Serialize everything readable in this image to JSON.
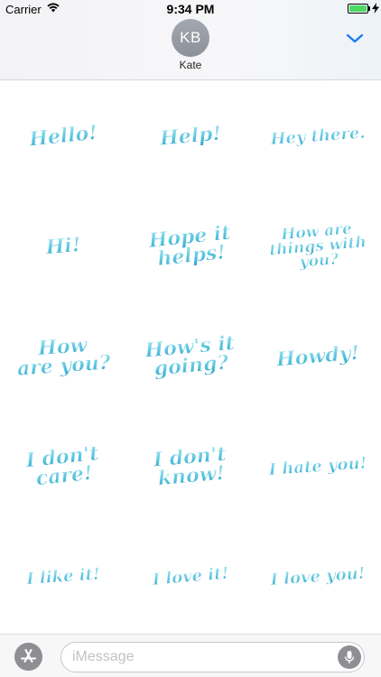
{
  "status_bar": {
    "carrier": "Carrier",
    "time": "9:34 PM",
    "battery_level": 1.0,
    "charging_icon": "bolt-icon",
    "wifi_icon": "wifi-icon"
  },
  "header": {
    "avatar_initials": "KB",
    "contact_name": "Kate",
    "collapse_icon": "chevron-down-icon"
  },
  "colors": {
    "accent": "#1a7cf5",
    "sticker_light": "#9fe3f0",
    "sticker_dark": "#2a9fc6",
    "avatar": "#979ba3"
  },
  "stickers": [
    {
      "lines": [
        "Hello!"
      ]
    },
    {
      "lines": [
        "Help!"
      ]
    },
    {
      "lines": [
        "Hey there."
      ]
    },
    {
      "lines": [
        "Hi!"
      ]
    },
    {
      "lines": [
        "Hope it",
        "helps!"
      ]
    },
    {
      "lines": [
        "How are",
        "things with",
        "you?"
      ]
    },
    {
      "lines": [
        "How",
        "are you?"
      ]
    },
    {
      "lines": [
        "How's it",
        "going?"
      ]
    },
    {
      "lines": [
        "Howdy!"
      ]
    },
    {
      "lines": [
        "I don't",
        "care!"
      ]
    },
    {
      "lines": [
        "I don't",
        "know!"
      ]
    },
    {
      "lines": [
        "I hate you!"
      ]
    },
    {
      "lines": [
        "I like it!"
      ]
    },
    {
      "lines": [
        "I love it!"
      ]
    },
    {
      "lines": [
        "I love you!"
      ]
    }
  ],
  "input_bar": {
    "placeholder": "iMessage",
    "value": "",
    "appstore_icon": "app-store-icon",
    "mic_icon": "microphone-icon"
  }
}
